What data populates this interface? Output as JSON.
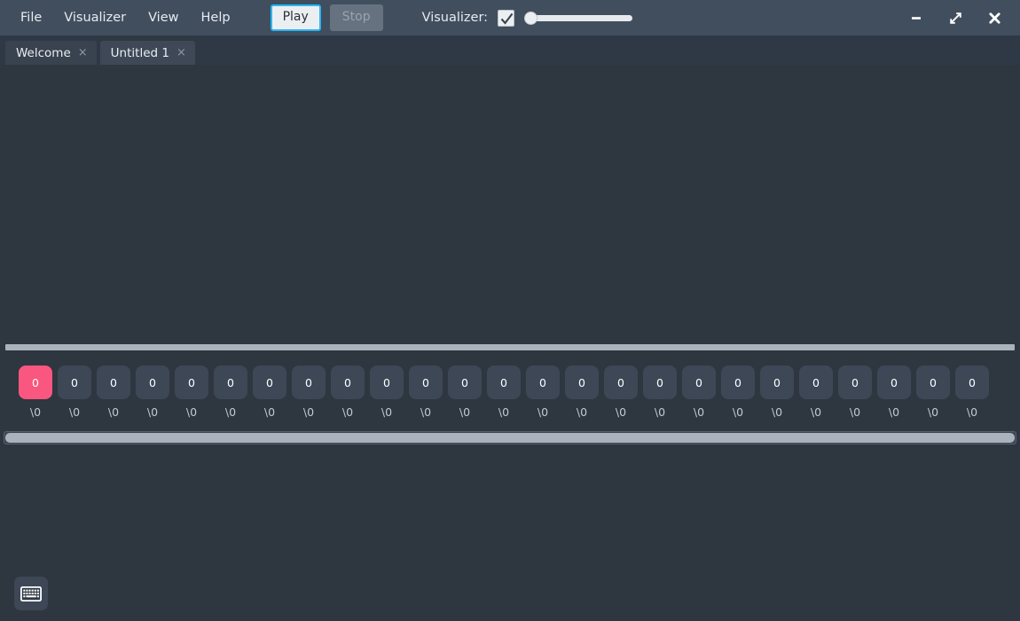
{
  "window": {
    "menu": [
      {
        "label": "File",
        "name": "menu-file"
      },
      {
        "label": "Visualizer",
        "name": "menu-visualizer"
      },
      {
        "label": "View",
        "name": "menu-view"
      },
      {
        "label": "Help",
        "name": "menu-help"
      }
    ],
    "controls": {
      "minimize": "minimize-icon",
      "maximize": "maximize-icon",
      "close": "close-icon"
    }
  },
  "toolbar": {
    "play_label": "Play",
    "stop_label": "Stop",
    "visualizer_label": "Visualizer:",
    "visualizer_checked": true,
    "visualizer_speed": 0,
    "accent_focus": "#29b6f6"
  },
  "tabs": [
    {
      "label": "Welcome",
      "close": "×",
      "active": false
    },
    {
      "label": "Untitled 1",
      "close": "×",
      "active": true
    }
  ],
  "editor": {
    "content": ""
  },
  "memory": {
    "selected_index": 0,
    "selected_color": "#f9577f",
    "cells": [
      {
        "value": "0",
        "label": "\\0"
      },
      {
        "value": "0",
        "label": "\\0"
      },
      {
        "value": "0",
        "label": "\\0"
      },
      {
        "value": "0",
        "label": "\\0"
      },
      {
        "value": "0",
        "label": "\\0"
      },
      {
        "value": "0",
        "label": "\\0"
      },
      {
        "value": "0",
        "label": "\\0"
      },
      {
        "value": "0",
        "label": "\\0"
      },
      {
        "value": "0",
        "label": "\\0"
      },
      {
        "value": "0",
        "label": "\\0"
      },
      {
        "value": "0",
        "label": "\\0"
      },
      {
        "value": "0",
        "label": "\\0"
      },
      {
        "value": "0",
        "label": "\\0"
      },
      {
        "value": "0",
        "label": "\\0"
      },
      {
        "value": "0",
        "label": "\\0"
      },
      {
        "value": "0",
        "label": "\\0"
      },
      {
        "value": "0",
        "label": "\\0"
      },
      {
        "value": "0",
        "label": "\\0"
      },
      {
        "value": "0",
        "label": "\\0"
      },
      {
        "value": "0",
        "label": "\\0"
      },
      {
        "value": "0",
        "label": "\\0"
      },
      {
        "value": "0",
        "label": "\\0"
      },
      {
        "value": "0",
        "label": "\\0"
      },
      {
        "value": "0",
        "label": "\\0"
      },
      {
        "value": "0",
        "label": "\\0"
      }
    ]
  },
  "bottom": {
    "keyboard_button": "keyboard-icon"
  }
}
